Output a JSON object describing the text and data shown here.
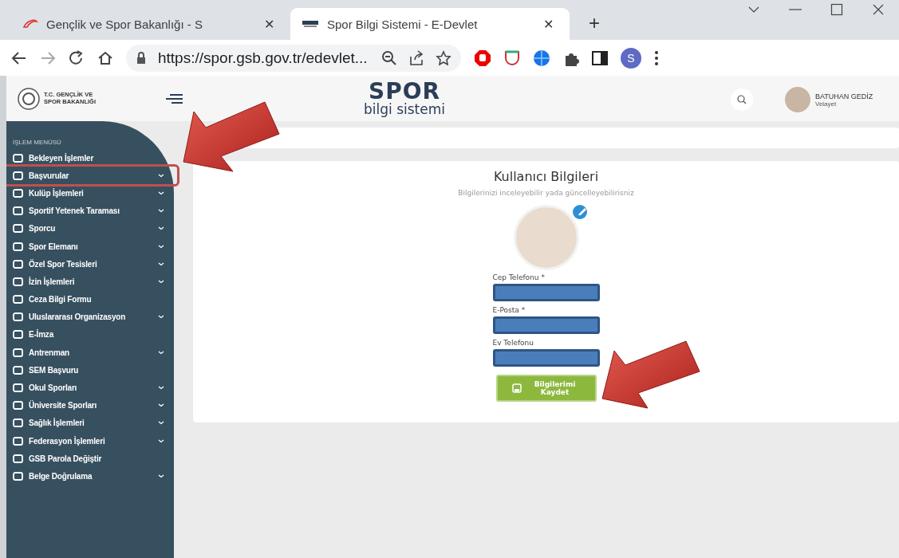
{
  "browser": {
    "tabs": [
      {
        "title": "Gençlik ve Spor Bakanlığı - S",
        "selected": false,
        "kind": "swoosh",
        "close": "✕"
      },
      {
        "title": "Spor Bilgi Sistemi - E-Devlet",
        "selected": true,
        "kind": "spor",
        "close": "✕"
      }
    ],
    "new_tab": "+",
    "url": "https://spor.gsb.gov.tr/edevlet...",
    "profile": "S"
  },
  "header": {
    "ministry": "T.C. GENÇLİK VE SPOR BAKANLIĞI",
    "logo_top": "SP",
    "logo_o": "O",
    "logo_r": "R",
    "logo_bottom": "bilgi sistemi",
    "user_name": "BATUHAN GEDİZ",
    "user_role": "Velayet"
  },
  "sidebar": {
    "heading": "İŞLEM MENÜSÜ",
    "items": [
      {
        "label": "Bekleyen İşlemler",
        "expandable": false,
        "highlighted": false
      },
      {
        "label": "Başvurular",
        "expandable": true,
        "highlighted": true
      },
      {
        "label": "Kulüp İşlemleri",
        "expandable": true,
        "highlighted": false
      },
      {
        "label": "Sportif Yetenek Taraması",
        "expandable": true,
        "highlighted": false
      },
      {
        "label": "Sporcu",
        "expandable": true,
        "highlighted": false
      },
      {
        "label": "Spor Elemanı",
        "expandable": true,
        "highlighted": false
      },
      {
        "label": "Özel Spor Tesisleri",
        "expandable": true,
        "highlighted": false
      },
      {
        "label": "İzin İşlemleri",
        "expandable": true,
        "highlighted": false
      },
      {
        "label": "Ceza Bilgi Formu",
        "expandable": false,
        "highlighted": false
      },
      {
        "label": "Uluslararası Organizasyon",
        "expandable": true,
        "highlighted": false
      },
      {
        "label": "E-İmza",
        "expandable": false,
        "highlighted": false
      },
      {
        "label": "Antrenman",
        "expandable": true,
        "highlighted": false
      },
      {
        "label": "SEM Başvuru",
        "expandable": false,
        "highlighted": false
      },
      {
        "label": "Okul Sporları",
        "expandable": true,
        "highlighted": false
      },
      {
        "label": "Üniversite Sporları",
        "expandable": true,
        "highlighted": false
      },
      {
        "label": "Sağlık İşlemleri",
        "expandable": true,
        "highlighted": false
      },
      {
        "label": "Federasyon İşlemleri",
        "expandable": true,
        "highlighted": false
      },
      {
        "label": "GSB Parola Değiştir",
        "expandable": false,
        "highlighted": false
      },
      {
        "label": "Belge Doğrulama",
        "expandable": true,
        "highlighted": false
      }
    ]
  },
  "card": {
    "title": "Kullanıcı Bilgileri",
    "subtitle": "Bilgilerinizi inceleyebilir yada güncelleyebilirisniz",
    "fields": [
      {
        "label": "Cep Telefonu *",
        "redacted": true
      },
      {
        "label": "E-Posta *",
        "redacted": true
      },
      {
        "label": "Ev Telefonu",
        "redacted": true
      }
    ],
    "save_button": "Bilgilerimi Kaydet"
  }
}
